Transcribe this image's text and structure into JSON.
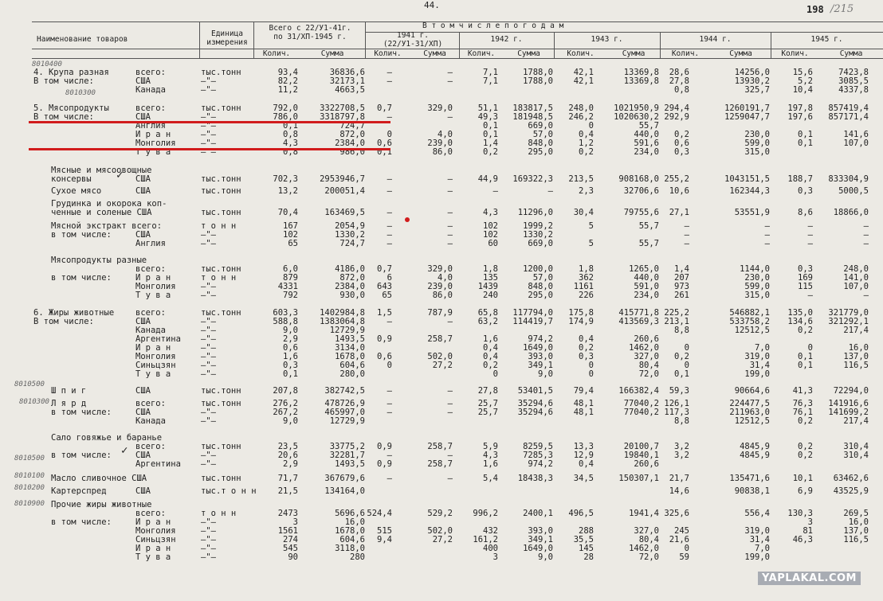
{
  "page_number": "44.",
  "stamp": "198",
  "stamp_hand": "/215",
  "watermark": "YAPLAKAL.COM",
  "headers": {
    "name": "Наименование товаров",
    "unit": "Единица измерения",
    "total_line1": "Всего с 22/У1-41г.",
    "total_line2": "по 31/XП-1945 г.",
    "by_years": "В   т о м   ч и с л е   п о   г о д а м",
    "y1941_line1": "1941 г.",
    "y1941_line2": "(22/У1-31/XП)",
    "y1942": "1942 г.",
    "y1943": "1943 г.",
    "y1944": "1944 г.",
    "y1945": "1945 г.",
    "qty": "Колич.",
    "sum": "Сумма"
  },
  "rows": [
    {
      "l0": "4. Крупа разная",
      "lab": "всего:",
      "u": "тыс.тонн",
      "v": [
        "93,4",
        "36836,6",
        "–",
        "–",
        "7,1",
        "1788,0",
        "42,1",
        "13369,8",
        "28,6",
        "14256,0",
        "15,6",
        "7423,8"
      ]
    },
    {
      "l0": "В том числе:",
      "lab": "США",
      "u": "–\"–",
      "v": [
        "82,2",
        "32173,1",
        "–",
        "–",
        "7,1",
        "1788,0",
        "42,1",
        "13369,8",
        "27,8",
        "13930,2",
        "5,2",
        "3085,5"
      ]
    },
    {
      "l0": "",
      "lab": "Канада",
      "u": "–\"–",
      "v": [
        "11,2",
        "4663,5",
        "",
        "",
        "",
        "",
        "",
        "",
        "0,8",
        "325,7",
        "10,4",
        "4337,8"
      ]
    },
    {
      "l0": "5. Мясопродукты",
      "lab": "всего:",
      "u": "тыс.тонн",
      "v": [
        "792,0",
        "3322708,5",
        "0,7",
        "329,0",
        "51,1",
        "183817,5",
        "248,0",
        "1021950,9",
        "294,4",
        "1260191,7",
        "197,8",
        "857419,4"
      ]
    },
    {
      "l0": "В том числе:",
      "lab": "США",
      "u": "–\"–",
      "v": [
        "786,0",
        "3318797,8",
        "–",
        "–",
        "49,3",
        "181948,5",
        "246,2",
        "1020630,2",
        "292,9",
        "1259047,7",
        "197,6",
        "857171,4"
      ]
    },
    {
      "l0": "",
      "lab": "Англия",
      "u": "–\"–",
      "v": [
        "0,1",
        "724,7",
        "",
        "",
        "0,1",
        "669,0",
        "0",
        "55,7",
        "",
        "",
        "",
        ""
      ]
    },
    {
      "l0": "",
      "lab": "И р а н",
      "u": "–\"–",
      "v": [
        "0,8",
        "872,0",
        "0",
        "4,0",
        "0,1",
        "57,0",
        "0,4",
        "440,0",
        "0,2",
        "230,0",
        "0,1",
        "141,6"
      ]
    },
    {
      "l0": "",
      "lab": "Монголия",
      "u": "–\"–",
      "v": [
        "4,3",
        "2384,0",
        "0,6",
        "239,0",
        "1,4",
        "848,0",
        "1,2",
        "591,6",
        "0,6",
        "599,0",
        "0,1",
        "107,0"
      ]
    },
    {
      "l0": "",
      "lab": "Т у в а",
      "u": "–\"–",
      "v": [
        "0,8",
        "986,0",
        "0,1",
        "86,0",
        "0,2",
        "295,0",
        "0,2",
        "234,0",
        "0,3",
        "315,0",
        "",
        ""
      ]
    },
    {
      "l0": "Мясные и мясоовощные",
      "lab": "",
      "u": "",
      "v": [
        "",
        "",
        "",
        "",
        "",
        "",
        "",
        "",
        "",
        "",
        "",
        ""
      ]
    },
    {
      "l0": "консервы",
      "lab": "США",
      "u": "тыс.тонн",
      "v": [
        "702,3",
        "2953946,7",
        "–",
        "–",
        "44,9",
        "169322,3",
        "213,5",
        "908168,0",
        "255,2",
        "1043151,5",
        "188,7",
        "833304,9"
      ]
    },
    {
      "l0": "Сухое мясо",
      "lab": "США",
      "u": "тыс.тонн",
      "v": [
        "13,2",
        "200051,4",
        "–",
        "–",
        "–",
        "–",
        "2,3",
        "32706,6",
        "10,6",
        "162344,3",
        "0,3",
        "5000,5"
      ]
    },
    {
      "l0": "Грудинка и окорока коп-",
      "lab": "",
      "u": "",
      "v": [
        "",
        "",
        "",
        "",
        "",
        "",
        "",
        "",
        "",
        "",
        "",
        ""
      ]
    },
    {
      "l0": "ченные и соленые США",
      "lab": "",
      "u": "тыс.тонн",
      "v": [
        "70,4",
        "163469,5",
        "–",
        "–",
        "4,3",
        "11296,0",
        "30,4",
        "79755,6",
        "27,1",
        "53551,9",
        "8,6",
        "18866,0"
      ]
    },
    {
      "l0": "Мясной экстракт всего:",
      "lab": "",
      "u": "т о н н",
      "v": [
        "167",
        "2054,9",
        "–",
        "–",
        "102",
        "1999,2",
        "5",
        "55,7",
        "–",
        "–",
        "–",
        "–"
      ]
    },
    {
      "l0": "в том числе:",
      "lab": "США",
      "u": "–\"–",
      "v": [
        "102",
        "1330,2",
        "–",
        "–",
        "102",
        "1330,2",
        "",
        "",
        "–",
        "–",
        "–",
        "–"
      ]
    },
    {
      "l0": "",
      "lab": "Англия",
      "u": "–\"–",
      "v": [
        "65",
        "724,7",
        "–",
        "–",
        "60",
        "669,0",
        "5",
        "55,7",
        "–",
        "–",
        "–",
        "–"
      ]
    },
    {
      "l0": "Мясопродукты разные",
      "lab": "",
      "u": "",
      "v": [
        "",
        "",
        "",
        "",
        "",
        "",
        "",
        "",
        "",
        "",
        "",
        ""
      ]
    },
    {
      "l0": "",
      "lab": "всего:",
      "u": "тыс.тонн",
      "v": [
        "6,0",
        "4186,0",
        "0,7",
        "329,0",
        "1,8",
        "1200,0",
        "1,8",
        "1265,0",
        "1,4",
        "1144,0",
        "0,3",
        "248,0"
      ]
    },
    {
      "l0": "в том числе:",
      "lab": "И р а н",
      "u": "т о н н",
      "v": [
        "879",
        "872,0",
        "6",
        "4,0",
        "135",
        "57,0",
        "362",
        "440,0",
        "207",
        "230,0",
        "169",
        "141,0"
      ]
    },
    {
      "l0": "",
      "lab": "Монголия",
      "u": "–\"–",
      "v": [
        "4331",
        "2384,0",
        "643",
        "239,0",
        "1439",
        "848,0",
        "1161",
        "591,0",
        "973",
        "599,0",
        "115",
        "107,0"
      ]
    },
    {
      "l0": "",
      "lab": "Т у в а",
      "u": "–\"–",
      "v": [
        "792",
        "930,0",
        "65",
        "86,0",
        "240",
        "295,0",
        "226",
        "234,0",
        "261",
        "315,0",
        "–",
        "–"
      ]
    },
    {
      "l0": "6. Жиры животные",
      "lab": "всего:",
      "u": "тыс.тонн",
      "v": [
        "603,3",
        "1402984,8",
        "1,5",
        "787,9",
        "65,8",
        "117794,0",
        "175,8",
        "415771,8",
        "225,2",
        "546882,1",
        "135,0",
        "321779,0"
      ]
    },
    {
      "l0": "В том числе:",
      "lab": "США",
      "u": "–\"–",
      "v": [
        "588,8",
        "1383064,8",
        "–",
        "–",
        "63,2",
        "114419,7",
        "174,9",
        "413569,3",
        "213,1",
        "533758,2",
        "134,6",
        "321292,1"
      ]
    },
    {
      "l0": "",
      "lab": "Канада",
      "u": "–\"–",
      "v": [
        "9,0",
        "12729,9",
        "",
        "",
        "",
        "",
        "",
        "",
        "8,8",
        "12512,5",
        "0,2",
        "217,4"
      ]
    },
    {
      "l0": "",
      "lab": "Аргентина",
      "u": "–\"–",
      "v": [
        "2,9",
        "1493,5",
        "0,9",
        "258,7",
        "1,6",
        "974,2",
        "0,4",
        "260,6",
        "",
        "",
        "",
        ""
      ]
    },
    {
      "l0": "",
      "lab": "И р а н",
      "u": "–\"–",
      "v": [
        "0,6",
        "3134,0",
        "",
        "",
        "0,4",
        "1649,0",
        "0,2",
        "1462,0",
        "0",
        "7,0",
        "0",
        "16,0"
      ]
    },
    {
      "l0": "",
      "lab": "Монголия",
      "u": "–\"–",
      "v": [
        "1,6",
        "1678,0",
        "0,6",
        "502,0",
        "0,4",
        "393,0",
        "0,3",
        "327,0",
        "0,2",
        "319,0",
        "0,1",
        "137,0"
      ]
    },
    {
      "l0": "",
      "lab": "Синьцзян",
      "u": "–\"–",
      "v": [
        "0,3",
        "604,6",
        "0",
        "27,2",
        "0,2",
        "349,1",
        "0",
        "80,4",
        "0",
        "31,4",
        "0,1",
        "116,5"
      ]
    },
    {
      "l0": "",
      "lab": "Т у в а",
      "u": "–\"–",
      "v": [
        "0,1",
        "280,0",
        "",
        "",
        "0",
        "9,0",
        "0",
        "72,0",
        "0,1",
        "199,0",
        "",
        ""
      ]
    },
    {
      "l0": "Ш п и г",
      "lab": "США",
      "u": "тыс.тонн",
      "v": [
        "207,8",
        "382742,5",
        "–",
        "–",
        "27,8",
        "53401,5",
        "79,4",
        "166382,4",
        "59,3",
        "90664,6",
        "41,3",
        "72294,0"
      ]
    },
    {
      "l0": "Л я р д",
      "lab": "всего:",
      "u": "тыс.тонн",
      "v": [
        "276,2",
        "478726,9",
        "–",
        "–",
        "25,7",
        "35294,6",
        "48,1",
        "77040,2",
        "126,1",
        "224477,5",
        "76,3",
        "141916,6"
      ]
    },
    {
      "l0": "в том числе:",
      "lab": "США",
      "u": "–\"–",
      "v": [
        "267,2",
        "465997,0",
        "–",
        "–",
        "25,7",
        "35294,6",
        "48,1",
        "77040,2",
        "117,3",
        "211963,0",
        "76,1",
        "141699,2"
      ]
    },
    {
      "l0": "",
      "lab": "Канада",
      "u": "–\"–",
      "v": [
        "9,0",
        "12729,9",
        "",
        "",
        "",
        "",
        "",
        "",
        "8,8",
        "12512,5",
        "0,2",
        "217,4"
      ]
    },
    {
      "l0": "Сало говяжье и баранье",
      "lab": "",
      "u": "",
      "v": [
        "",
        "",
        "",
        "",
        "",
        "",
        "",
        "",
        "",
        "",
        "",
        ""
      ]
    },
    {
      "l0": "",
      "lab": "всего:",
      "u": "тыс.тонн",
      "v": [
        "23,5",
        "33775,2",
        "0,9",
        "258,7",
        "5,9",
        "8259,5",
        "13,3",
        "20100,7",
        "3,2",
        "4845,9",
        "0,2",
        "310,4"
      ]
    },
    {
      "l0": "в том числе:",
      "lab": "США",
      "u": "–\"–",
      "v": [
        "20,6",
        "32281,7",
        "–",
        "–",
        "4,3",
        "7285,3",
        "12,9",
        "19840,1",
        "3,2",
        "4845,9",
        "0,2",
        "310,4"
      ]
    },
    {
      "l0": "",
      "lab": "Аргентина",
      "u": "–\"–",
      "v": [
        "2,9",
        "1493,5",
        "0,9",
        "258,7",
        "1,6",
        "974,2",
        "0,4",
        "260,6",
        "",
        "",
        "",
        ""
      ]
    },
    {
      "l0": "Масло сливочное США",
      "lab": "",
      "u": "тыс.тонн",
      "v": [
        "71,7",
        "367679,6",
        "–",
        "–",
        "5,4",
        "18438,3",
        "34,5",
        "150307,1",
        "21,7",
        "135471,6",
        "10,1",
        "63462,6"
      ]
    },
    {
      "l0": "Картерспред",
      "lab": "США",
      "u": "тыс.т о н н",
      "v": [
        "21,5",
        "134164,0",
        "",
        "",
        "",
        "",
        "",
        "",
        "14,6",
        "90838,1",
        "6,9",
        "43525,9"
      ]
    },
    {
      "l0": "Прочие жиры животные",
      "lab": "",
      "u": "",
      "v": [
        "",
        "",
        "",
        "",
        "",
        "",
        "",
        "",
        "",
        "",
        "",
        ""
      ]
    },
    {
      "l0": "",
      "lab": "всего:",
      "u": "т о н н",
      "v": [
        "2473",
        "5696,6",
        "524,4",
        "529,2",
        "996,2",
        "2400,1",
        "496,5",
        "1941,4",
        "325,6",
        "556,4",
        "130,3",
        "269,5"
      ]
    },
    {
      "l0": "в том числе:",
      "lab": "И р а н",
      "u": "–\"–",
      "v": [
        "3",
        "16,0",
        "",
        "",
        "",
        "",
        "",
        "",
        "",
        "",
        "3",
        "16,0"
      ]
    },
    {
      "l0": "",
      "lab": "Монголия",
      "u": "–\"–",
      "v": [
        "1561",
        "1678,0",
        "515",
        "502,0",
        "432",
        "393,0",
        "288",
        "327,0",
        "245",
        "319,0",
        "81",
        "137,0"
      ]
    },
    {
      "l0": "",
      "lab": "Синьцзян",
      "u": "–\"–",
      "v": [
        "274",
        "604,6",
        "9,4",
        "27,2",
        "161,2",
        "349,1",
        "35,5",
        "80,4",
        "21,6",
        "31,4",
        "46,3",
        "116,5"
      ]
    },
    {
      "l0": "",
      "lab": "И р а н",
      "u": "–\"–",
      "v": [
        "545",
        "3118,0",
        "",
        "",
        "400",
        "1649,0",
        "145",
        "1462,0",
        "0",
        "7,0",
        "",
        ""
      ]
    },
    {
      "l0": "",
      "lab": "Т у в а",
      "u": "–\"–",
      "v": [
        "90",
        "280",
        "",
        "",
        "3",
        "9,0",
        "28",
        "72,0",
        "59",
        "199,0",
        "",
        ""
      ]
    }
  ],
  "margin_codes": [
    "8010400",
    "8010300",
    "8010500",
    "8010100",
    "8010200",
    "8010900"
  ]
}
